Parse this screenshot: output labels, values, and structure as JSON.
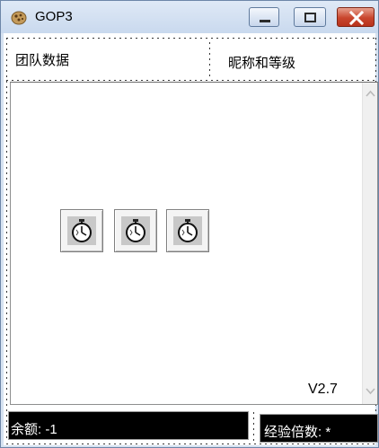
{
  "window": {
    "title": "GOP3",
    "app_icon": "cookie-icon",
    "controls": [
      "minimize-icon",
      "maximize-icon",
      "close-icon"
    ]
  },
  "header": {
    "left_label": "团队数据",
    "right_label": "昵称和等级"
  },
  "content": {
    "timer_icons": [
      "stopwatch-icon",
      "stopwatch-icon",
      "stopwatch-icon"
    ],
    "version": "V2.7"
  },
  "status": {
    "balance": "余额: -1",
    "exp_multiplier": "经验倍数: *"
  },
  "colors": {
    "titlebar": "#d6e2f1",
    "close_button": "#c9452d",
    "status_bg": "#000000",
    "status_text": "#ffffff"
  }
}
